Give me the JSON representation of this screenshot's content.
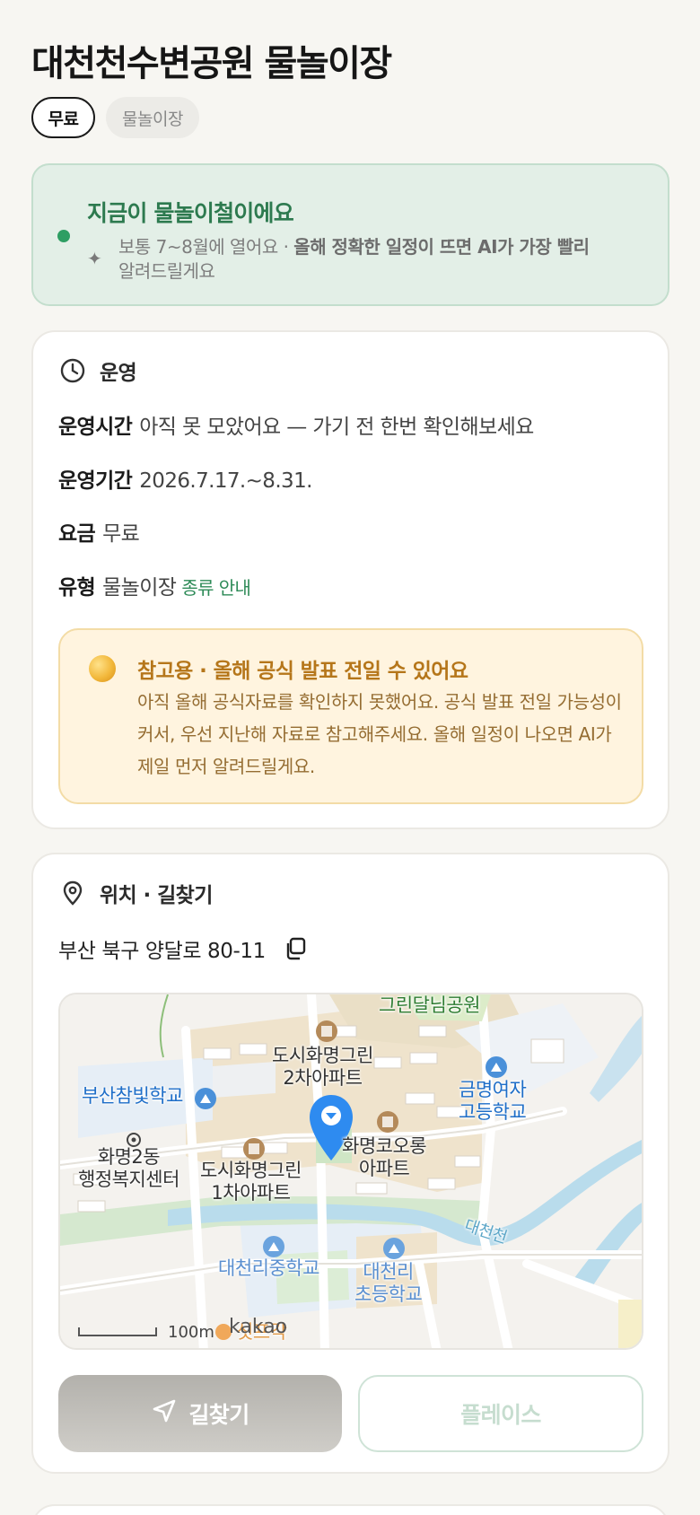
{
  "header": {
    "title": "대천천수변공원 물놀이장",
    "chips": {
      "free": "무료",
      "type": "물놀이장"
    }
  },
  "season": {
    "title": "지금이 물놀이철이에요",
    "text_plain": "보통 7~8월에 열어요 · ",
    "text_bold": "올해 정확한 일정이 뜨면 AI가 가장 빨리",
    "text_tail": "알려드릴게요",
    "sparkle_icon": "sparkle-icon"
  },
  "operation": {
    "heading": "운영",
    "icon": "clock-icon",
    "rows": [
      {
        "key": "운영시간",
        "value": "아직 못 모았어요 — 가기 전 한번 확인해보세요"
      },
      {
        "key": "운영기간",
        "value": "2026.7.17.~8.31."
      },
      {
        "key": "요금",
        "value": "무료"
      },
      {
        "key": "유형",
        "value": "물놀이장",
        "link": "종류 안내"
      }
    ],
    "notice": {
      "title": "참고용 · 올해 공식 발표 전일 수 있어요",
      "body": "아직 올해 공식자료를 확인하지 못했어요. 공식 발표 전일 가능성이 커서, 우선 지난해 자료로 참고해주세요. 올해 일정이 나오면 AI가 제일 먼저 알려드릴게요."
    }
  },
  "location": {
    "heading": "위치 · 길찾기",
    "icon": "location-pin-icon",
    "address": "부산 북구 양달로 80-11",
    "copy_icon": "copy-icon",
    "map": {
      "labels": {
        "park": "그린달님공원",
        "apt2_l1": "도시화명그린",
        "apt2_l2": "2차아파트",
        "school1": "부산참빛학교",
        "girls_l1": "금명여자",
        "girls_l2": "고등학교",
        "center_l1": "화명2동",
        "center_l2": "행정복지센터",
        "apt1_l1": "도시화명그린",
        "apt1_l2": "1차아파트",
        "kolon_l1": "화명코오롱",
        "kolon_l2": "아파트",
        "stream": "대천천",
        "middle": "대천리중학교",
        "elem_l1": "대천리",
        "elem_l2": "초등학교",
        "partial": "섯프각",
        "scale": "100m",
        "brand": "kakao"
      }
    },
    "buttons": {
      "directions": "길찾기",
      "place": "플레이스"
    }
  },
  "colors": {
    "accent_green": "#2d7a4f",
    "notice_text": "#b5761a",
    "map_marker": "#2e8bf0"
  }
}
